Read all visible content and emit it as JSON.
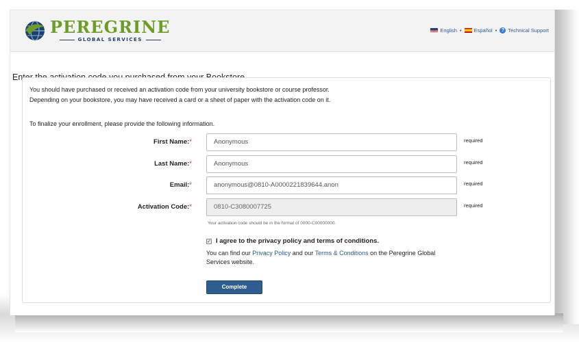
{
  "brand": {
    "name": "PEREGRINE",
    "sub": "GLOBAL SERVICES",
    "primary_color": "#6d9c2a",
    "secondary_color": "#1f3f6a"
  },
  "lang_bar": {
    "english": "English",
    "espanol": "Español",
    "support": "Technical Support",
    "separator": "•"
  },
  "page": {
    "title": "Enter the activation code you purchased from your Bookstore"
  },
  "intro": {
    "line1": "You should have purchased or received an activation code from your university bookstore or course professor.",
    "line2": "Depending on your bookstore, you may have received a card or a sheet of paper with the activation code on it.",
    "finalize": "To finalize your enrollment, please provide the following information."
  },
  "form": {
    "required_star": "*",
    "fields": [
      {
        "label": "First Name:",
        "value": "Anonymous",
        "required": "required",
        "disabled": false
      },
      {
        "label": "Last Name:",
        "value": "Anonymous",
        "required": "required",
        "disabled": false
      },
      {
        "label": "Email:",
        "value": "anonymous@0810-A0000221839644.anon",
        "required": "required",
        "disabled": false
      },
      {
        "label": "Activation Code:",
        "value": "0810-C3080007725",
        "required": "required",
        "disabled": true
      }
    ],
    "activation_hint": "Your activation code should be in the format of 0000-C00000000.",
    "agree_label": "I agree to the privacy policy and terms of conditions.",
    "agree_checked": true,
    "checkmark": "✓",
    "find_prefix": "You can find our ",
    "privacy_link": "Privacy Policy",
    "find_and": " and our ",
    "terms_link": "Terms & Conditions",
    "find_suffix": " on the Peregrine Global Services website.",
    "complete_label": "Complete",
    "button_color": "#2f5d8f"
  }
}
